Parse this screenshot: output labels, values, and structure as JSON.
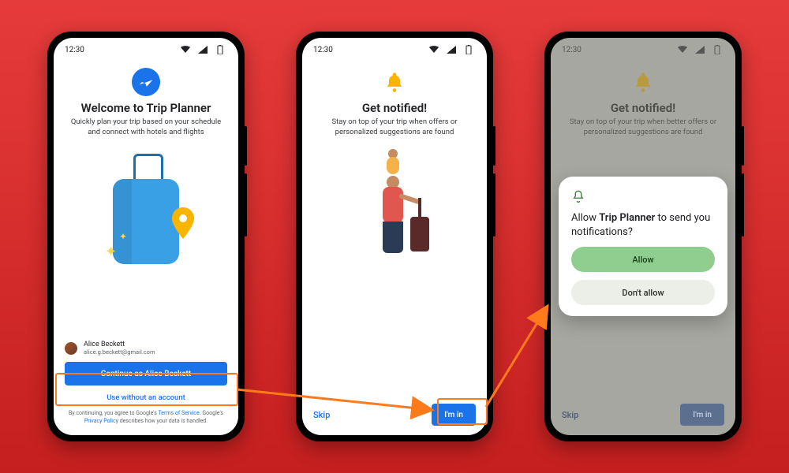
{
  "status": {
    "time": "12:30"
  },
  "screen1": {
    "title": "Welcome to Trip Planner",
    "subtitle": "Quickly plan your trip based on your schedule and connect with hotels and flights",
    "account": {
      "name": "Alice Beckett",
      "email": "alice.g.beckett@gmail.com"
    },
    "continue_label": "Continue as Alice Beckett",
    "no_account_label": "Use without an account",
    "legal_prefix": "By continuing, you agree to Google's ",
    "tos": "Terms of Service",
    "legal_mid": ". Google's ",
    "privacy": "Privacy Policy",
    "legal_suffix": " describes how your data is handled."
  },
  "screen2": {
    "title": "Get notified!",
    "subtitle": "Stay on top of your trip when offers or personalized suggestions are found",
    "skip_label": "Skip",
    "accept_label": "I'm in"
  },
  "screen3": {
    "title": "Get notified!",
    "subtitle": "Stay on top of your trip when better offers or personalized suggestions are found",
    "skip_label": "Skip",
    "accept_label": "I'm in"
  },
  "dialog": {
    "prefix": "Allow ",
    "app": "Trip Planner",
    "suffix": " to send you notifications?",
    "allow": "Allow",
    "deny": "Don't allow"
  },
  "icons": {
    "plane": "plane-icon",
    "bell": "bell-icon",
    "pin": "location-pin-icon"
  },
  "colors": {
    "accent": "#1a73e8",
    "highlight": "#ff7a1a",
    "bell": "#f7b500",
    "allow": "#8fce8f"
  }
}
